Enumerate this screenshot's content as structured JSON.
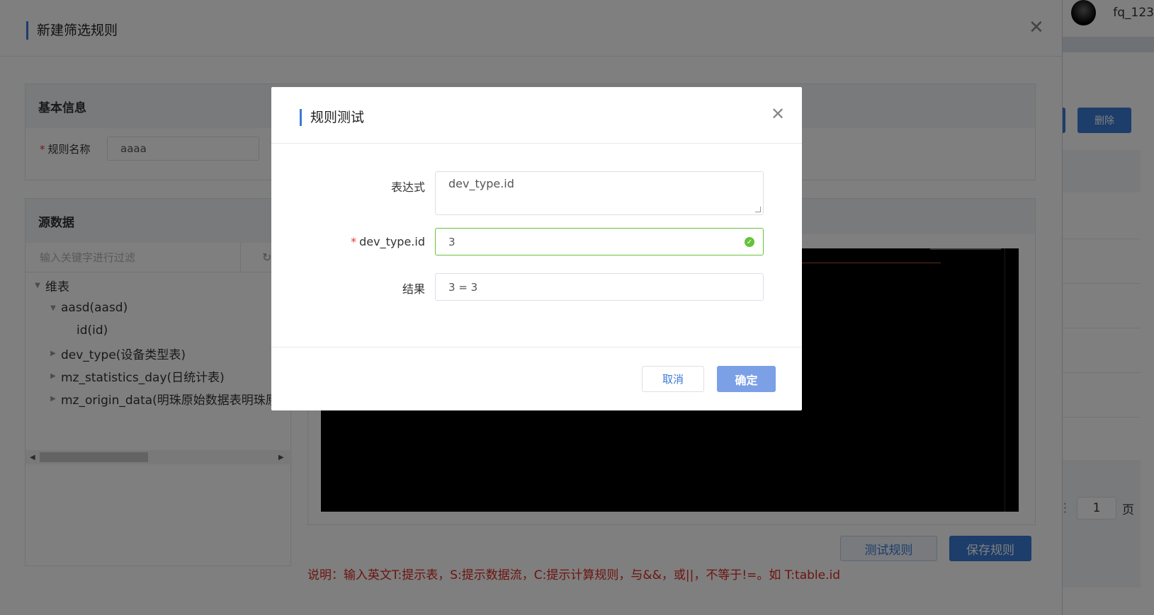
{
  "background": {
    "username": "fq_123",
    "delete_button": "删除",
    "page_number": "1",
    "page_suffix": "页"
  },
  "drawer": {
    "title": "新建筛选规则",
    "close_icon": "close-icon",
    "basic_info": {
      "heading": "基本信息",
      "rule_name_label": "规则名称",
      "rule_name_value": "aaaa"
    },
    "source": {
      "heading": "源数据",
      "filter_placeholder": "输入关键字进行过滤",
      "tree": [
        {
          "label": "维表",
          "level": 0,
          "expanded": true
        },
        {
          "label": "aasd(aasd)",
          "level": 1,
          "expanded": true
        },
        {
          "label": "id(id)",
          "level": 2,
          "leaf": true
        },
        {
          "label": "dev_type(设备类型表)",
          "level": 1,
          "expanded": false
        },
        {
          "label": "mz_statistics_day(日统计表)",
          "level": 1,
          "expanded": false
        },
        {
          "label": "mz_origin_data(明珠原始数据表明珠原",
          "level": 1,
          "expanded": false
        }
      ]
    },
    "test_rule_button": "测试规则",
    "save_rule_button": "保存规则",
    "note": "说明：输入英文T:提示表，S:提示数据流，C:提示计算规则，与&&，或||，不等于!=。如 T:table.id"
  },
  "modal": {
    "title": "规则测试",
    "expression_label": "表达式",
    "expression_value": "dev_type.id",
    "param_label": "dev_type.id",
    "param_value": "3",
    "result_label": "结果",
    "result_value": "3 = 3",
    "cancel_button": "取消",
    "ok_button": "确定"
  },
  "colors": {
    "accent": "#3a7bd5",
    "success": "#67c23a",
    "note": "#d8281f"
  }
}
